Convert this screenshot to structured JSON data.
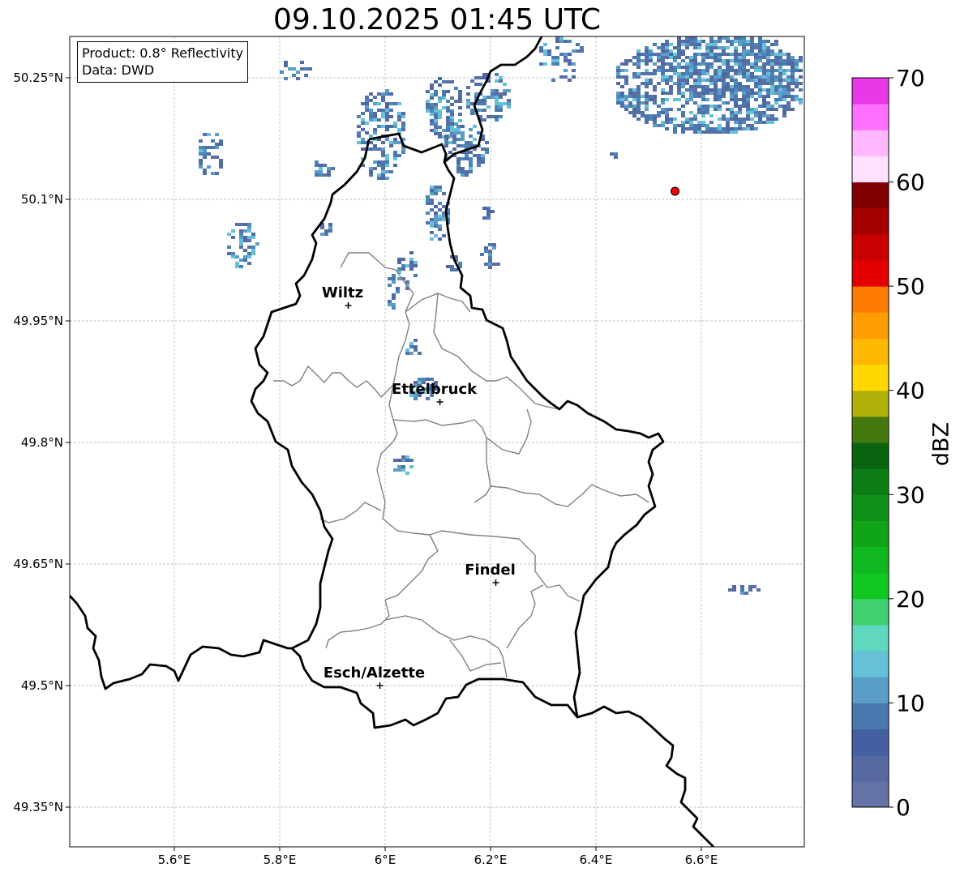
{
  "title": "09.10.2025 01:45 UTC",
  "info": {
    "product": "Product: 0.8° Reflectivity",
    "data": "Data: DWD"
  },
  "axes": {
    "lon_ticks": [
      {
        "value": 5.6,
        "label": "5.6°E"
      },
      {
        "value": 5.8,
        "label": "5.8°E"
      },
      {
        "value": 6.0,
        "label": "6°E"
      },
      {
        "value": 6.2,
        "label": "6.2°E"
      },
      {
        "value": 6.4,
        "label": "6.4°E"
      },
      {
        "value": 6.6,
        "label": "6.6°E"
      }
    ],
    "lat_ticks": [
      {
        "value": 50.25,
        "label": "50.25°N"
      },
      {
        "value": 50.1,
        "label": "50.1°N"
      },
      {
        "value": 49.95,
        "label": "49.95°N"
      },
      {
        "value": 49.8,
        "label": "49.8°N"
      },
      {
        "value": 49.65,
        "label": "49.65°N"
      },
      {
        "value": 49.5,
        "label": "49.5°N"
      },
      {
        "value": 49.35,
        "label": "49.35°N"
      }
    ],
    "grid": true
  },
  "cities": [
    {
      "name": "Wiltz",
      "lon": 5.93,
      "lat": 49.969
    },
    {
      "name": "Ettelbruck",
      "lon": 6.104,
      "lat": 49.85
    },
    {
      "name": "Findel",
      "lon": 6.21,
      "lat": 49.627
    },
    {
      "name": "Esch/Alzette",
      "lon": 5.99,
      "lat": 49.5
    }
  ],
  "marker": {
    "lon": 6.55,
    "lat": 50.11,
    "color": "#ee0000"
  },
  "colorbar": {
    "label": "dBZ",
    "min": 0,
    "max": 70,
    "step": 2.5,
    "tick_labels": [
      "0",
      "10",
      "20",
      "30",
      "40",
      "50",
      "60",
      "70"
    ],
    "colors": [
      "#6572a6",
      "#5569a0",
      "#4560a0",
      "#4a78b0",
      "#5a9ec8",
      "#66c0d8",
      "#60d8c0",
      "#40d070",
      "#10c820",
      "#10b820",
      "#10a418",
      "#10901a",
      "#0c7c14",
      "#0a6410",
      "#467810",
      "#b0b008",
      "#ffd800",
      "#ffb800",
      "#ff9c00",
      "#ff7c00",
      "#e40000",
      "#c80000",
      "#a40000",
      "#800000",
      "#ffe0ff",
      "#ffb8ff",
      "#ff70ff",
      "#e838e8"
    ]
  },
  "legend": {
    "product_line": "Product: 0.8° Reflectivity",
    "source_line": "Data: DWD"
  }
}
